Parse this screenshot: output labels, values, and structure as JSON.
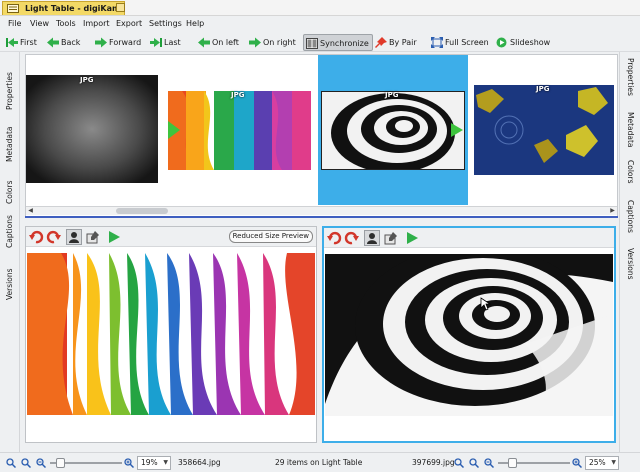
{
  "window": {
    "title": "Light Table - digiKam"
  },
  "menu": [
    "File",
    "View",
    "Tools",
    "Import",
    "Export",
    "Settings",
    "Help"
  ],
  "toolbar": {
    "first": "First",
    "back": "Back",
    "forward": "Forward",
    "last": "Last",
    "on_left": "On left",
    "on_right": "On right",
    "synchronize": "Synchronize",
    "by_pair": "By Pair",
    "full_screen": "Full Screen",
    "slideshow": "Slideshow"
  },
  "left_sidebar": [
    "Properties",
    "Metadata",
    "Colors",
    "Captions",
    "Versions"
  ],
  "right_sidebar": [
    "Properties",
    "Metadata",
    "Colors",
    "Captions",
    "Versions"
  ],
  "thumbbar": {
    "items": [
      {
        "tag": "JPG"
      },
      {
        "tag": "JPG"
      },
      {
        "tag": "JPG"
      },
      {
        "tag": "JPG"
      }
    ]
  },
  "left_pane": {
    "reduced_preview": "Reduced Size Preview"
  },
  "status": {
    "left_zoom": "19%",
    "left_file": "358664.jpg",
    "count": "29 items on Light Table",
    "right_file": "397699.jpg",
    "right_zoom": "25%"
  },
  "colors": {
    "accent": "#3daee9",
    "title_tab": "#f3d966"
  }
}
